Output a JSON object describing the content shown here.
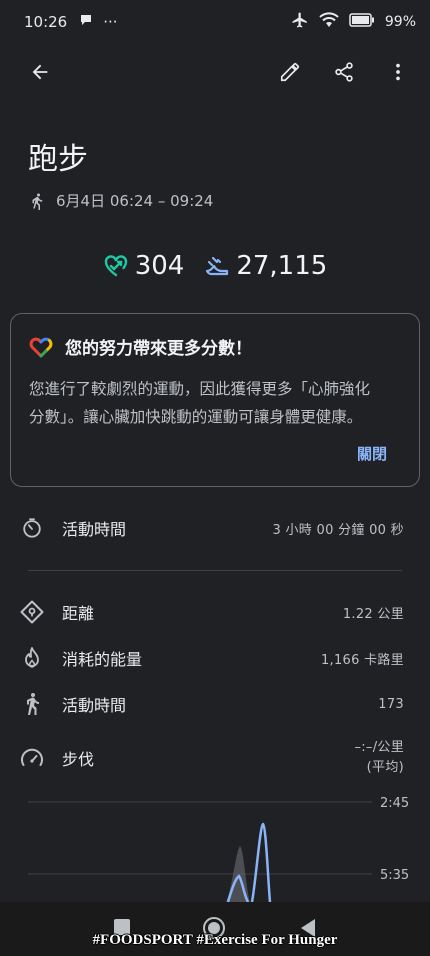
{
  "status_bar": {
    "time": "10:26",
    "more_indicator": "···",
    "battery": "99%"
  },
  "activity": {
    "title": "跑步",
    "datetime": "6月4日 06:24 – 09:24"
  },
  "metrics": {
    "heart_points": "304",
    "steps": "27,115"
  },
  "card": {
    "title": "您的努力帶來更多分數！",
    "body_line1": "您進行了較劇烈的運動，因此獲得更多「心肺強化",
    "body_line2": "分數」。讓心臟加快跳動的運動可讓身體更健康。",
    "action": "關閉"
  },
  "stats": [
    {
      "label": "活動時間",
      "value": "3 小時 00 分鐘 00 秒",
      "icon": "timer-icon"
    },
    {
      "label": "距離",
      "value": "1.22 公里",
      "icon": "location-icon"
    },
    {
      "label": "消耗的能量",
      "value": "1,166 卡路里",
      "icon": "flame-icon"
    },
    {
      "label": "活動時間",
      "value": "173",
      "icon": "walking-icon"
    },
    {
      "label": "步伐",
      "value_line1": "–:–/公里",
      "value_line2": "(平均)",
      "icon": "speedometer-icon"
    }
  ],
  "chart_data": {
    "type": "line",
    "tick_labels": [
      "2:45",
      "5:35"
    ],
    "line_color": "#8ab4f8"
  },
  "watermark": "#FOODSPORT #Exercise For Hunger",
  "colors": {
    "background": "#202124",
    "heart_accent": "#1ec8a5",
    "steps_accent": "#8ab4f8",
    "link": "#8ab4f8"
  }
}
